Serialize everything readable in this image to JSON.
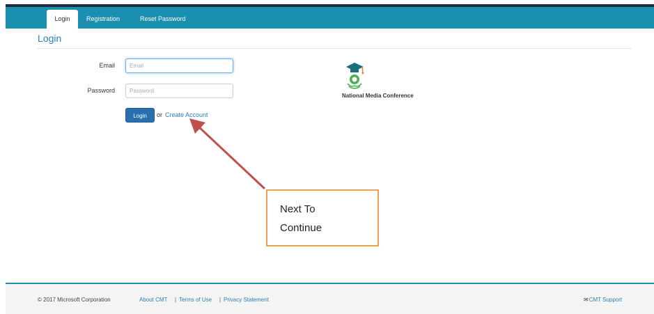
{
  "nav": {
    "tabs": [
      {
        "label": "Login",
        "active": true
      },
      {
        "label": "Registration",
        "active": false
      },
      {
        "label": "Reset Password",
        "active": false
      }
    ]
  },
  "page": {
    "title": "Login"
  },
  "form": {
    "email_label": "Email",
    "email_placeholder": "Email",
    "email_value": "",
    "password_label": "Password",
    "password_placeholder": "Password",
    "password_value": "",
    "login_button": "Login",
    "or_text": "or",
    "create_account_link": "Create Account"
  },
  "conference": {
    "name": "National Media Conference",
    "logo_icon": "graduation-cap-logo-icon"
  },
  "annotation": {
    "line1": "Next To",
    "line2": "Continue",
    "arrow_color": "#c0504d",
    "box_border": "#f0a050"
  },
  "footer": {
    "copyright": "© 2017 Microsoft Corporation",
    "links": [
      "About CMT",
      "Terms of Use",
      "Privacy Statement"
    ],
    "separator": "|",
    "support_label": "CMT Support",
    "support_icon": "envelope-icon"
  },
  "colors": {
    "navbar": "#1a8fb0",
    "link": "#2a7fb8",
    "button": "#2a6fb0"
  }
}
